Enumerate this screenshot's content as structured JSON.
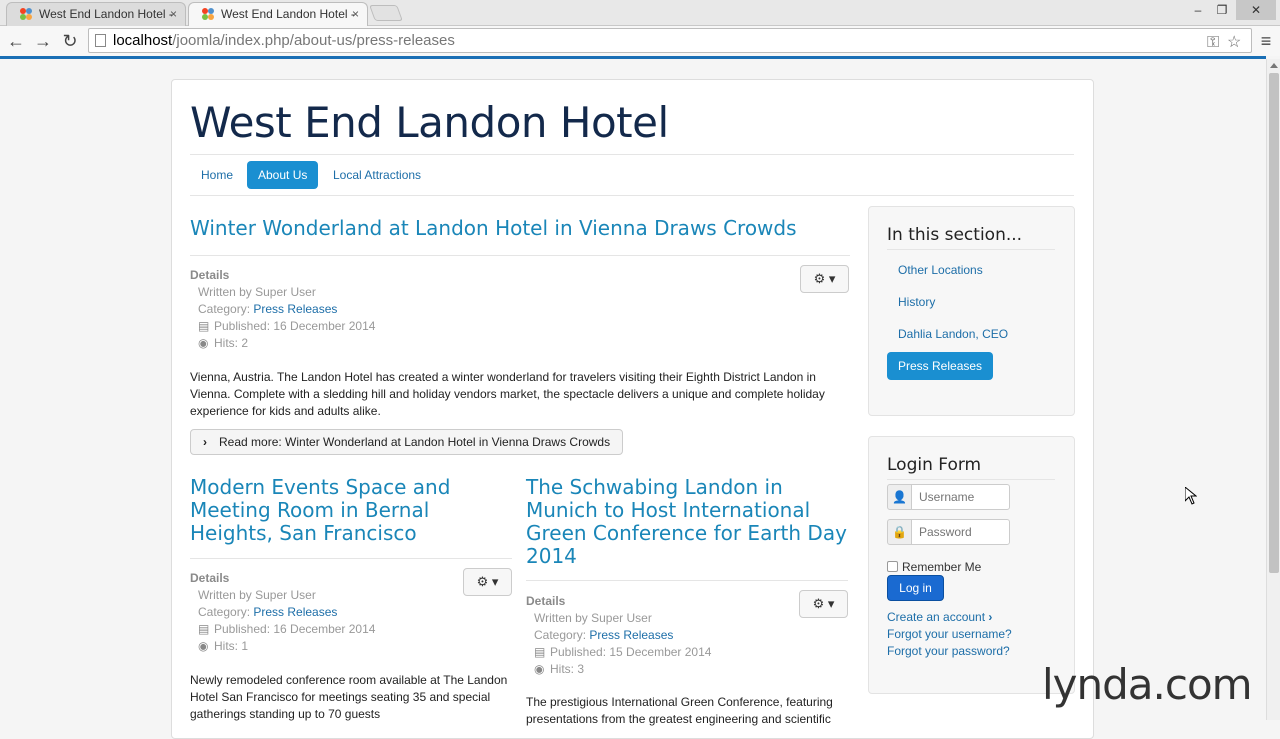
{
  "browser": {
    "tabs": [
      {
        "title": "West End Landon Hotel - "
      },
      {
        "title": "West End Landon Hotel - "
      }
    ],
    "close_glyph": "×",
    "url_host": "localhost",
    "url_path": "/joomla/index.php/about-us/press-releases",
    "back_icon": "←",
    "forward_icon": "→",
    "reload_icon": "↻",
    "minimize_icon": "‒",
    "maximize_icon": "❐",
    "close_icon": "✕",
    "key_icon": "⚿",
    "star_icon": "☆",
    "menu_icon": "≡"
  },
  "site": {
    "title": "West End Landon Hotel",
    "nav": [
      {
        "label": "Home",
        "active": false
      },
      {
        "label": "About Us",
        "active": true
      },
      {
        "label": "Local Attractions",
        "active": false
      }
    ]
  },
  "articles": [
    {
      "title": "Winter Wonderland at Landon Hotel in Vienna Draws Crowds",
      "details_label": "Details",
      "written_by": "Written by Super User",
      "category_prefix": "Category: ",
      "category": "Press Releases",
      "published": "Published: 16 December 2014",
      "hits": "Hits: 2",
      "body": "Vienna, Austria. The Landon Hotel has created a winter wonderland for travelers visiting their Eighth District Landon in Vienna. Complete with a sledding hill and holiday vendors market, the spectacle delivers a unique and complete holiday experience for kids and adults alike.",
      "read_more": "Read more: Winter Wonderland at Landon Hotel in Vienna Draws Crowds"
    },
    {
      "title": "Modern Events Space and Meeting Room in Bernal Heights, San Francisco",
      "details_label": "Details",
      "written_by": "Written by Super User",
      "category_prefix": "Category: ",
      "category": "Press Releases",
      "published": "Published: 16 December 2014",
      "hits": "Hits: 1",
      "body": "Newly remodeled conference room available at The Landon Hotel San Francisco for meetings seating 35 and special gatherings standing up to 70 guests"
    },
    {
      "title": "The Schwabing Landon in Munich to Host International Green Conference for Earth Day 2014",
      "details_label": "Details",
      "written_by": "Written by Super User",
      "category_prefix": "Category: ",
      "category": "Press Releases",
      "published": "Published: 15 December 2014",
      "hits": "Hits: 3",
      "body": "The prestigious International Green Conference, featuring presentations from the greatest engineering and scientific"
    }
  ],
  "sidebar": {
    "section_title": "In this section...",
    "links": [
      {
        "label": "Other Locations",
        "active": false
      },
      {
        "label": "History",
        "active": false
      },
      {
        "label": "Dahlia Landon, CEO",
        "active": false
      },
      {
        "label": "Press Releases",
        "active": true
      }
    ],
    "login": {
      "title": "Login Form",
      "username_placeholder": "Username",
      "password_placeholder": "Password",
      "remember_label": "Remember Me",
      "login_button": "Log in",
      "create_account": "Create an account",
      "forgot_username": "Forgot your username?",
      "forgot_password": "Forgot your password?"
    }
  },
  "watermark": "lynda.com",
  "colors": {
    "accent": "#1a8fd1",
    "title": "#13294b",
    "link": "#1d6ea8"
  }
}
